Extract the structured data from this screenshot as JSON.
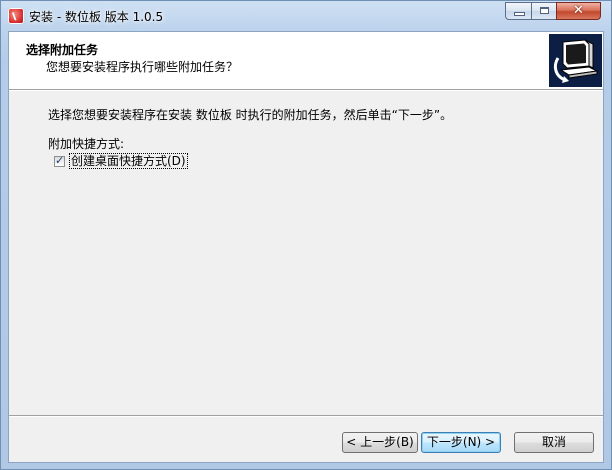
{
  "window": {
    "title": "安装 - 数位板 版本 1.0.5",
    "icons": {
      "app": "setup-icon",
      "minimize": "minimize-icon",
      "maximize": "maximize-icon",
      "close": "close-icon"
    },
    "close_glyph": "✕"
  },
  "header": {
    "title": "选择附加任务",
    "subtitle": "您想要安装程序执行哪些附加任务？",
    "image_icon": "computer-install-icon"
  },
  "body": {
    "description": "选择您想要安装程序在安装 数位板 时执行的附加任务，然后单击“下一步”。",
    "group_label": "附加快捷方式:",
    "tasks": [
      {
        "label": "创建桌面快捷方式(D)",
        "checked": true
      }
    ]
  },
  "buttons": {
    "back": "< 上一步(B)",
    "next": "下一步(N) >",
    "cancel": "取消"
  },
  "colors": {
    "frame": "#b4cce7",
    "header_bg": "#ffffff",
    "client_bg": "#f0f0f0",
    "close_button": "#c24a2e",
    "default_button_border": "#3c7fb1",
    "image_bg": "#0d1e44"
  }
}
